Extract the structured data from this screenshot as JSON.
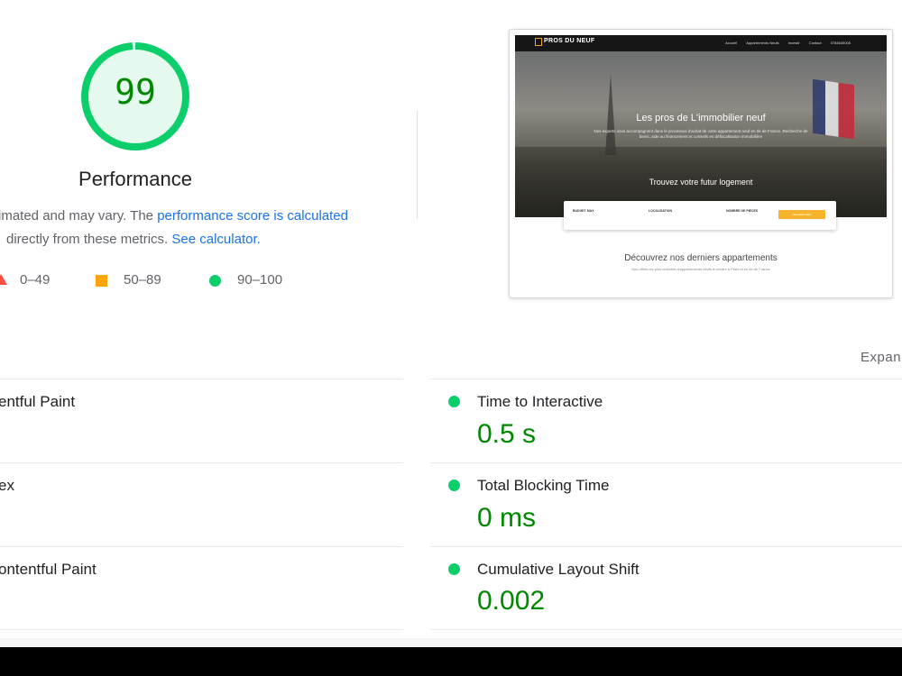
{
  "score": {
    "value": "99",
    "label": "Performance",
    "fraction": 0.99,
    "color": "#0cce6b"
  },
  "description": {
    "line1_prefix": "imated and may vary. The ",
    "line1_link": "performance score is calculated",
    "line2_prefix": "directly from these metrics. ",
    "line2_link": "See calculator."
  },
  "legend": [
    {
      "range": "0–49",
      "color": "#ff4e42",
      "icon": "triangle-icon"
    },
    {
      "range": "50–89",
      "color": "#ffa400",
      "icon": "square-icon"
    },
    {
      "range": "90–100",
      "color": "#0cce6b",
      "icon": "circle-icon"
    }
  ],
  "screenshot": {
    "brand": "PROS DU NEUF",
    "nav": [
      "Accueil",
      "Appartements Neufs",
      "Investir",
      "Contact",
      "0784645005"
    ],
    "hero_title": "Les pros de L'immobilier neuf",
    "hero_sub": "Nos experts vous accompagnent dans le processus d'achat de votre appartement neuf en Ile de France. Recherche de biens, aide au financement et conseils en défiscalisation immobilière",
    "search_title": "Trouvez votre futur logement",
    "fields": [
      "BUDGET MAX",
      "LOCALISATION",
      "NOMBRE DE PIECES"
    ],
    "button": "RECHERCHER",
    "section_title": "Découvrez nos derniers appartements",
    "section_sub": "Nos offres les plus récentes d'appartements neufs à vendre à Paris et en Ile de France"
  },
  "expand_label": "Expan",
  "metrics_left": [
    {
      "title": "entful Paint"
    },
    {
      "title": "ex"
    },
    {
      "title": "ontentful Paint"
    }
  ],
  "metrics_right": [
    {
      "title": "Time to Interactive",
      "value": "0.5 s"
    },
    {
      "title": "Total Blocking Time",
      "value": "0 ms"
    },
    {
      "title": "Cumulative Layout Shift",
      "value": "0.002"
    }
  ]
}
